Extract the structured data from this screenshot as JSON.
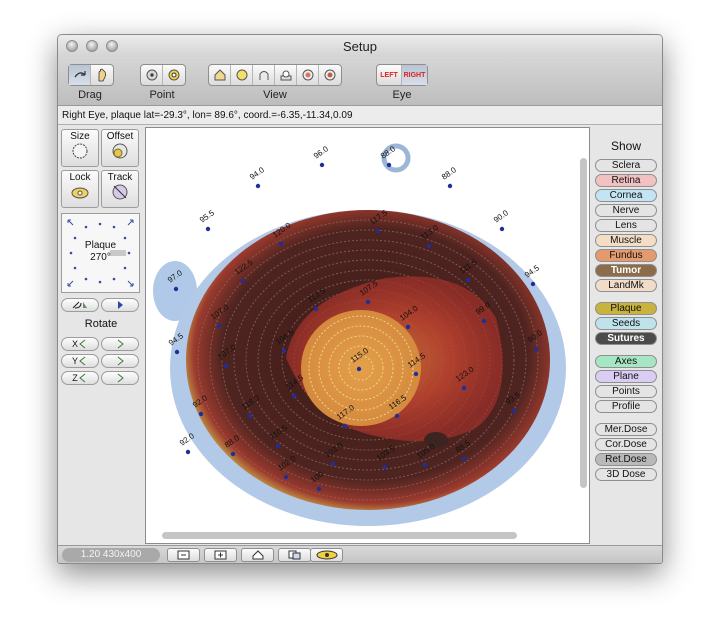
{
  "window": {
    "title": "Setup"
  },
  "toolbar": {
    "groups": [
      {
        "label": "Drag",
        "icons": [
          "rotate-drag-icon",
          "hand-drag-icon"
        ]
      },
      {
        "label": "Point",
        "icons": [
          "point-view-icon",
          "point-target-icon"
        ]
      },
      {
        "label": "View",
        "icons": [
          "home-view-icon",
          "top-view-icon",
          "side-view-icon",
          "bottom-view-icon",
          "front-view-icon",
          "back-view-icon"
        ]
      },
      {
        "label": "Eye",
        "icons": [
          "left-eye-icon",
          "right-eye-icon"
        ]
      }
    ],
    "eye_left": "LEFT",
    "eye_right": "RIGHT"
  },
  "status": {
    "text": "Right Eye, plaque lat=-29.3°, lon= 89.6°, coord.=-6.35,-11.34,0.09"
  },
  "left_panel": {
    "size_label": "Size",
    "offset_label": "Offset",
    "lock_label": "Lock",
    "track_label": "Track",
    "plaque_label": "Plaque",
    "plaque_angle": "270°",
    "rotate_label": "Rotate",
    "axes": [
      "X",
      "Y",
      "Z"
    ]
  },
  "right_panel": {
    "title": "Show",
    "buttons": [
      {
        "label": "Sclera",
        "color": "#e4e4e4"
      },
      {
        "label": "Retina",
        "color": "#f2c2c2"
      },
      {
        "label": "Cornea",
        "color": "#c4e3f3"
      },
      {
        "label": "Nerve",
        "color": "#e4e4e4"
      },
      {
        "label": "Lens",
        "color": "#e4e4e4"
      },
      {
        "label": "Muscle",
        "color": "#f3ddc4"
      },
      {
        "label": "Fundus",
        "color": "#e59a6d"
      },
      {
        "label": "Tumor",
        "color": "#8d6c4c"
      },
      {
        "label": "LandMk",
        "color": "#f1dcc8"
      },
      {
        "label": "Plaque",
        "color": "#c8b33c"
      },
      {
        "label": "Seeds",
        "color": "#bfe3ea"
      },
      {
        "label": "Sutures",
        "color": "#4b4b4b"
      },
      {
        "label": "Axes",
        "color": "#a6e6c3"
      },
      {
        "label": "Plane",
        "color": "#d9cdf3"
      },
      {
        "label": "Points",
        "color": "#e4e4e4"
      },
      {
        "label": "Profile",
        "color": "#e4e4e4"
      },
      {
        "label": "Mer.Dose",
        "color": "#e4e4e4"
      },
      {
        "label": "Cor.Dose",
        "color": "#e4e4e4"
      },
      {
        "label": "Ret.Dose",
        "color": "#b9b9b9"
      },
      {
        "label": "3D Dose",
        "color": "#e4e4e4"
      }
    ]
  },
  "viewport": {
    "labels": [
      "94.0",
      "96.0",
      "88.0",
      "88.0",
      "95.5",
      "90.0",
      "94.5",
      "97.0",
      "90.0",
      "94.5",
      "92.0",
      "93.5",
      "92.0",
      "88.5",
      "88.0",
      "100",
      "120.0",
      "117.5",
      "113.0",
      "111.5",
      "122.5",
      "113.5",
      "107.5",
      "104.0",
      "107.0",
      "99.0",
      "104.5",
      "107.0",
      "114.5",
      "114.5",
      "115.0",
      "123.0",
      "118.0",
      "116.5",
      "117.0",
      "110.5",
      "103.5",
      "102.0",
      "105.0",
      "103.0"
    ]
  },
  "bottom_bar": {
    "zoom_text": "1.20 430x400",
    "buttons": [
      "zoom-out-icon",
      "zoom-in-icon",
      "home-icon",
      "copy-icon",
      "eye-icon"
    ]
  }
}
